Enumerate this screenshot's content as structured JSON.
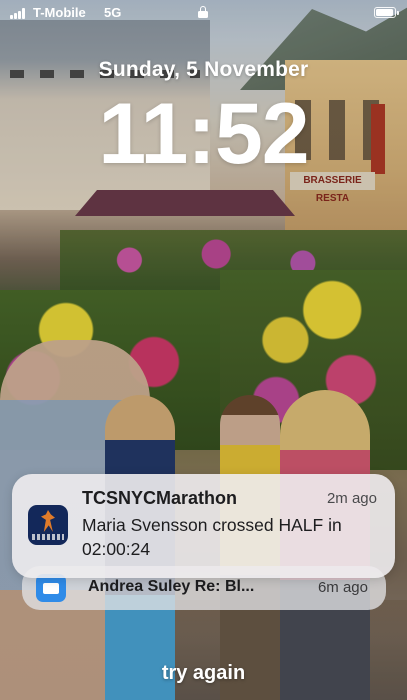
{
  "status_bar": {
    "carrier": "T-Mobile",
    "network": "5G",
    "signal_bars": 4,
    "battery_level": 0.95,
    "lock_icon": "lock-icon",
    "battery_icon": "battery-icon"
  },
  "lock_screen": {
    "date": "Sunday, 5 November",
    "time": "11:52"
  },
  "wallpaper": {
    "sign_text": "BRASSERIE RESTA"
  },
  "notifications": [
    {
      "app": "TCSNYCMarathon",
      "time_ago": "2m ago",
      "body": "Maria Svensson crossed HALF in 02:00:24",
      "icon": "marathon-app-icon",
      "icon_color": "#13285a"
    },
    {
      "sender": "Andrea Suley",
      "preview": "Re: Bl...",
      "time_ago": "6m ago",
      "icon": "mail-app-icon",
      "icon_color": "#2f8be8"
    }
  ],
  "footer": {
    "hint": "try again"
  }
}
